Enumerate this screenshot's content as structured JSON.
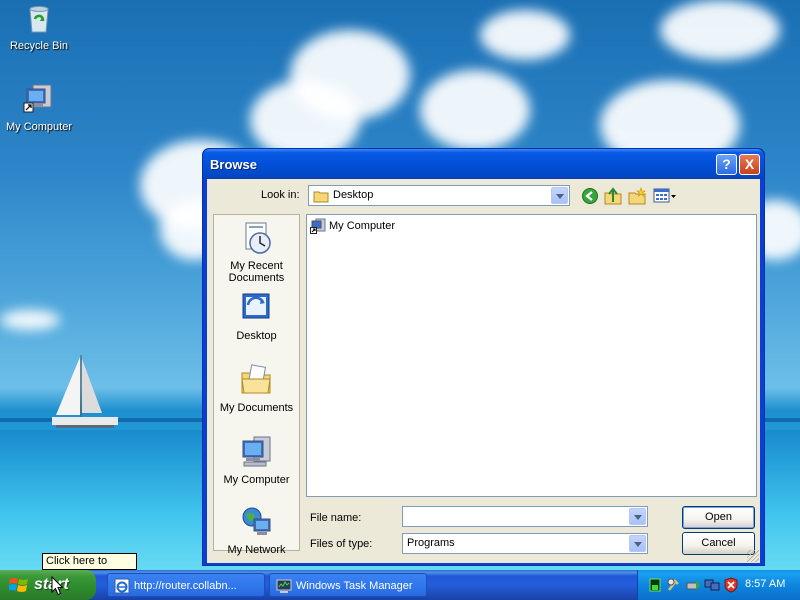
{
  "desktop": {
    "icons": [
      {
        "label": "Recycle Bin",
        "icon": "recycle-bin-icon"
      },
      {
        "label": "My Computer",
        "icon": "my-computer-icon"
      }
    ]
  },
  "dialog": {
    "title": "Browse",
    "help_button": "?",
    "close_button": "X",
    "look_in_label": "Look in:",
    "look_in_value": "Desktop",
    "toolbar": [
      "back-icon",
      "up-folder-icon",
      "new-folder-icon",
      "views-menu-icon"
    ],
    "places": [
      {
        "label": "My Recent Documents",
        "icon": "recent-documents-icon"
      },
      {
        "label": "Desktop",
        "icon": "desktop-icon"
      },
      {
        "label": "My Documents",
        "icon": "my-documents-icon"
      },
      {
        "label": "My Computer",
        "icon": "my-computer-icon"
      },
      {
        "label": "My Network",
        "icon": "my-network-icon"
      }
    ],
    "files": [
      {
        "label": "My Computer",
        "icon": "my-computer-shortcut-icon"
      }
    ],
    "file_name_label": "File name:",
    "file_name_value": "",
    "files_of_type_label": "Files of type:",
    "files_of_type_value": "Programs",
    "open_button": "Open",
    "cancel_button": "Cancel"
  },
  "tooltip": "Click here to begin",
  "taskbar": {
    "start_label": "start",
    "tasks": [
      {
        "label": "http://router.collabn...",
        "icon": "internet-explorer-icon"
      },
      {
        "label": "Windows Task Manager",
        "icon": "task-manager-icon"
      }
    ],
    "tray_icons": [
      "cpu-meter-icon",
      "network-tools-icon",
      "safely-remove-icon",
      "network-connection-icon",
      "security-shield-icon"
    ],
    "clock": "8:57 AM"
  },
  "colors": {
    "titlebar": "#0350d8",
    "taskbar": "#245edb",
    "start_button": "#3c9a3a",
    "dialog_face": "#ece9d8"
  }
}
